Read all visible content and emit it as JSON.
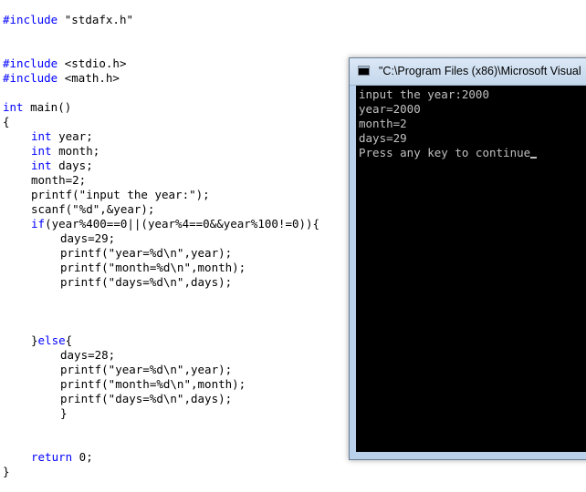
{
  "code": {
    "l1_kw": "#include",
    "l1_rest": " \"stdafx.h\"",
    "l2_kw": "#include",
    "l2_rest": " <stdio.h>",
    "l3_kw": "#include",
    "l3_rest": " <math.h>",
    "l4_kw": "int",
    "l4_rest": " main()",
    "l5": "{",
    "l6_kw": "int",
    "l6_rest": " year;",
    "l7_kw": "int",
    "l7_rest": " month;",
    "l8_kw": "int",
    "l8_rest": " days;",
    "l9": "month=2;",
    "l10": "printf(\"input the year:\");",
    "l11": "scanf(\"%d\",&year);",
    "l12_kw": "if",
    "l12_rest": "(year%400==0||(year%4==0&&year%100!=0)){",
    "l13": "days=29;",
    "l14": "printf(\"year=%d\\n\",year);",
    "l15": "printf(\"month=%d\\n\",month);",
    "l16": "printf(\"days=%d\\n\",days);",
    "l17_a": "}",
    "l17_kw": "else",
    "l17_b": "{",
    "l18": "days=28;",
    "l19": "printf(\"year=%d\\n\",year);",
    "l20": "printf(\"month=%d\\n\",month);",
    "l21": "printf(\"days=%d\\n\",days);",
    "l22": "}",
    "l23_kw": "return",
    "l23_rest": " 0;",
    "l24": "}"
  },
  "console": {
    "title": "\"C:\\Program Files (x86)\\Microsoft Visual",
    "lines": [
      "input the year:2000",
      "year=2000",
      "month=2",
      "days=29",
      "Press any key to continue"
    ]
  },
  "colors": {
    "keyword": "#0000ff",
    "console_bg": "#000000",
    "console_text": "#c0c0c0"
  }
}
